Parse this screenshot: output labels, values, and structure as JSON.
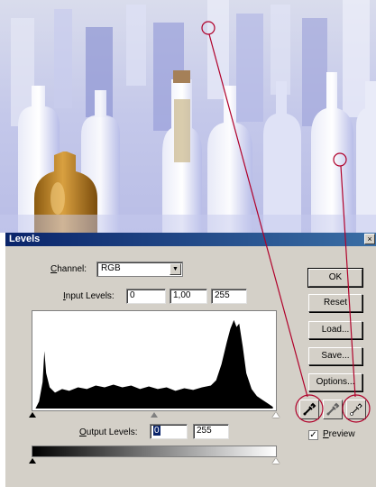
{
  "dialog": {
    "title": "Levels",
    "close_glyph": "×",
    "channel": {
      "label_u": "C",
      "label_rest": "hannel:",
      "value": "RGB"
    },
    "input_levels": {
      "label_u": "I",
      "label_rest": "nput Levels:",
      "black": "0",
      "gamma": "1,00",
      "white": "255"
    },
    "output_levels": {
      "label_u": "O",
      "label_rest": "utput Levels:",
      "black": "0",
      "white": "255"
    },
    "buttons": {
      "ok": "OK",
      "reset": "Reset",
      "load": "Load...",
      "save": "Save...",
      "options": "Options..."
    },
    "preview": {
      "label_u": "P",
      "label_rest": "review",
      "checked_glyph": "✓",
      "checked": true
    },
    "eyedroppers": [
      "black-point-eyedropper-icon",
      "gray-point-eyedropper-icon",
      "white-point-eyedropper-icon"
    ]
  },
  "colors": {
    "titlebar": "#0a246a",
    "dialog_bg": "#d4d0c8",
    "annotation": "#b0002a",
    "amber_bottle": "#b07818",
    "glass": "#c8cfee"
  }
}
